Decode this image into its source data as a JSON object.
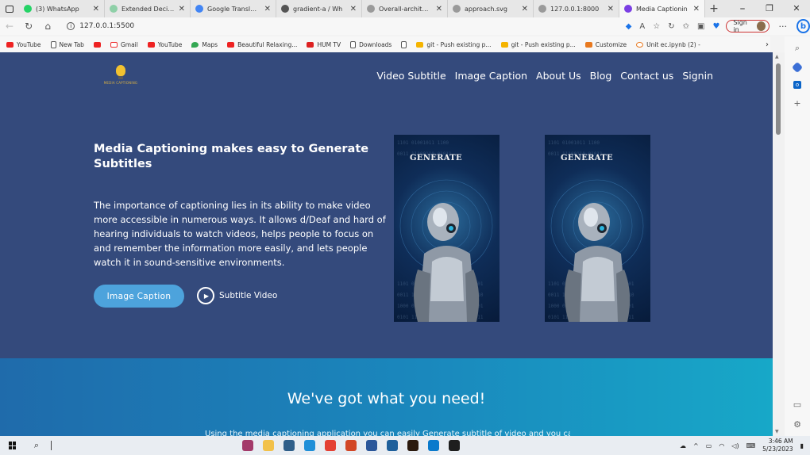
{
  "browser": {
    "tabs": [
      {
        "title": "(3) WhatsApp",
        "icon": "whatsapp-icon",
        "color": "#25d366",
        "active": false
      },
      {
        "title": "Extended Decisio",
        "icon": "page-icon",
        "color": "#8fd0a8",
        "active": false
      },
      {
        "title": "Google Translate",
        "icon": "translate-icon",
        "color": "#4285f4",
        "active": false
      },
      {
        "title": "gradient-a / Wh",
        "icon": "github-icon",
        "color": "#555555",
        "active": false
      },
      {
        "title": "Overall-architect",
        "icon": "page-icon",
        "color": "#9a9a9a",
        "active": false
      },
      {
        "title": "approach.svg",
        "icon": "page-icon",
        "color": "#9a9a9a",
        "active": false
      },
      {
        "title": "127.0.0.1:8000",
        "icon": "page-icon",
        "color": "#9a9a9a",
        "active": false
      },
      {
        "title": "Media Captionin",
        "icon": "bootstrap-icon",
        "color": "#7b3fe4",
        "active": true
      }
    ],
    "new_tab": "+",
    "close_glyph": "✕",
    "window_controls": [
      "⎯",
      "❐",
      "✕"
    ],
    "url": "127.0.0.1:5500",
    "signin_label": "Sign in",
    "more": "···",
    "bing_label": "b",
    "bookmarks": [
      {
        "label": "YouTube",
        "icon": "yt"
      },
      {
        "label": "New Tab",
        "icon": "doc"
      },
      {
        "label": "",
        "icon": "yt"
      },
      {
        "label": "Gmail",
        "icon": "gm"
      },
      {
        "label": "YouTube",
        "icon": "yt"
      },
      {
        "label": "Maps",
        "icon": "map"
      },
      {
        "label": "Beautiful Relaxing...",
        "icon": "yt"
      },
      {
        "label": "HUM TV",
        "icon": "hum"
      },
      {
        "label": "Downloads",
        "icon": "doc"
      },
      {
        "label": "",
        "icon": "doc"
      },
      {
        "label": "git - Push existing p...",
        "icon": "pen"
      },
      {
        "label": "git - Push existing p...",
        "icon": "pen"
      },
      {
        "label": "Customize",
        "icon": "cus"
      },
      {
        "label": "Unit ec.ipynb (2) -",
        "icon": "uni"
      }
    ]
  },
  "site": {
    "logo_text": "MEDIA CAPTIONING",
    "nav": [
      "Video Subtitle",
      "Image Caption",
      "About Us",
      "Blog",
      "Contact us",
      "Signin"
    ],
    "hero": {
      "title": "Media Captioning makes easy to Generate Subtitles",
      "text": "The importance of captioning lies in its ability to make video more accessible in numerous ways. It allows d/Deaf and hard of hearing individuals to watch videos, helps people to focus on and remember the information more easily, and lets people watch it in sound-sensitive environments.",
      "primary_button": "Image Caption",
      "secondary_button": "Subtitle Video"
    },
    "cards": [
      {
        "label": "GENERATE"
      },
      {
        "label": "GENERATE"
      }
    ],
    "section": {
      "title": "We've got what you need!",
      "subtitle": "Using the media captioning application you can easily Generate subtitle of video and you can"
    }
  },
  "taskbar": {
    "time": "3:46 AM",
    "date": "5/23/2023",
    "apps": [
      {
        "icon": "winrar-icon",
        "color": "#a33a6a"
      },
      {
        "icon": "file-explorer-icon",
        "color": "#f2c14a"
      },
      {
        "icon": "app-icon",
        "color": "#2f5f8a"
      },
      {
        "icon": "edge-icon",
        "color": "#1f8fd8"
      },
      {
        "icon": "chrome-icon",
        "color": "#e44134"
      },
      {
        "icon": "powerpoint-icon",
        "color": "#d24726"
      },
      {
        "icon": "word-icon",
        "color": "#2b579a"
      },
      {
        "icon": "photos-icon",
        "color": "#1e5f9b"
      },
      {
        "icon": "illustrator-icon",
        "color": "#2b1a0e"
      },
      {
        "icon": "vscode-icon",
        "color": "#0a7acc"
      },
      {
        "icon": "terminal-icon",
        "color": "#1e1e1e"
      }
    ]
  }
}
